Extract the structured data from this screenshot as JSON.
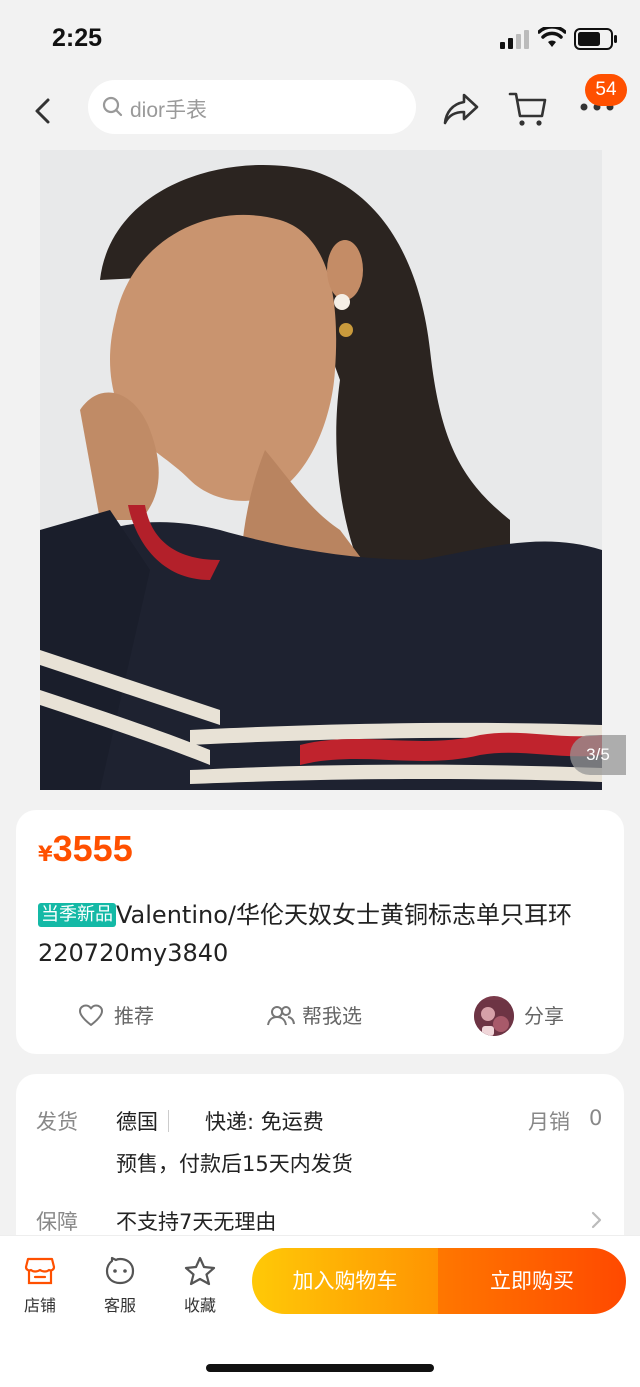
{
  "status": {
    "time": "2:25"
  },
  "nav": {
    "search_placeholder": "dior手表",
    "badge_count": "54"
  },
  "gallery": {
    "page_indicator": "3/5"
  },
  "product": {
    "currency": "¥",
    "price": "3555",
    "season_tag": "当季新品",
    "title": "Valentino/华伦天奴女士黄铜标志单只耳环 220720my3840"
  },
  "actions": {
    "recommend": "推荐",
    "help_choose": "帮我选",
    "share": "分享"
  },
  "shipping": {
    "ship_label": "发货",
    "origin": "德国",
    "express": "快递: 免运费",
    "monthly_sales_label": "月销",
    "monthly_sales_value": "0",
    "ship_note": "预售，付款后15天内发货",
    "guarantee_label": "保障",
    "guarantee_value": "不支持7天无理由"
  },
  "bottom": {
    "shop": "店铺",
    "service": "客服",
    "favorite": "收藏",
    "add_to_cart": "加入购物车",
    "buy_now": "立即购买"
  },
  "colors": {
    "accent": "#ff5000",
    "tag": "#14b9a6",
    "cart_button": "#ffb005",
    "buy_button": "#ff5a00"
  }
}
